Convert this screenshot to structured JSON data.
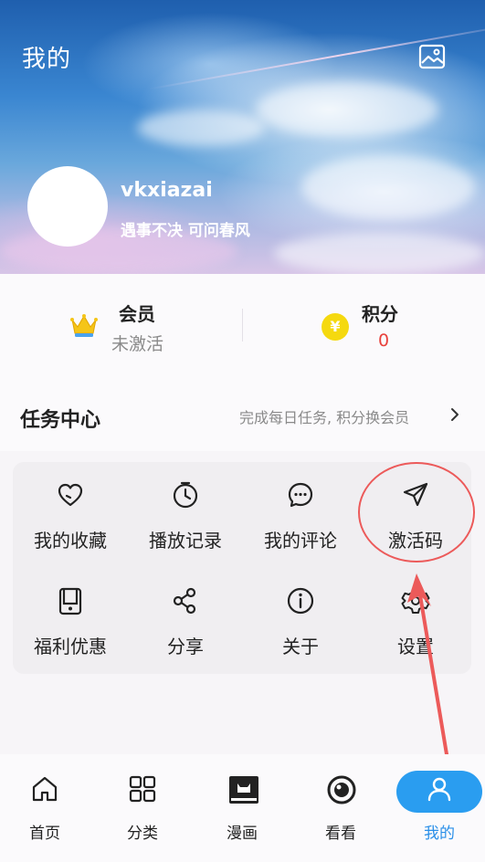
{
  "header": {
    "title": "我的",
    "image_button_icon": "image-icon"
  },
  "profile": {
    "username": "vkxiazai",
    "motto": "遇事不决 可问春风"
  },
  "stats": {
    "member": {
      "icon": "crown-icon",
      "title": "会员",
      "status": "未激活"
    },
    "points": {
      "icon": "coin-icon",
      "coin_glyph": "¥",
      "title": "积分",
      "value": "0"
    }
  },
  "task_center": {
    "title": "任务中心",
    "hint": "完成每日任务, 积分换会员",
    "chevron_icon": "chevron-right-icon"
  },
  "functions": [
    {
      "label": "我的收藏",
      "icon": "heart-icon"
    },
    {
      "label": "播放记录",
      "icon": "clock-icon"
    },
    {
      "label": "我的评论",
      "icon": "comment-icon"
    },
    {
      "label": "激活码",
      "icon": "send-icon"
    },
    {
      "label": "福利优惠",
      "icon": "coupon-icon"
    },
    {
      "label": "分享",
      "icon": "share-icon"
    },
    {
      "label": "关于",
      "icon": "info-icon"
    },
    {
      "label": "设置",
      "icon": "settings-icon"
    }
  ],
  "annotation": {
    "color": "#ec5a5a"
  },
  "tabbar": {
    "items": [
      {
        "label": "首页",
        "icon": "home-icon"
      },
      {
        "label": "分类",
        "icon": "grid-icon"
      },
      {
        "label": "漫画",
        "icon": "comic-icon"
      },
      {
        "label": "看看",
        "icon": "eye-icon"
      },
      {
        "label": "我的",
        "icon": "user-icon"
      }
    ],
    "active_color": "#2a9df0"
  }
}
